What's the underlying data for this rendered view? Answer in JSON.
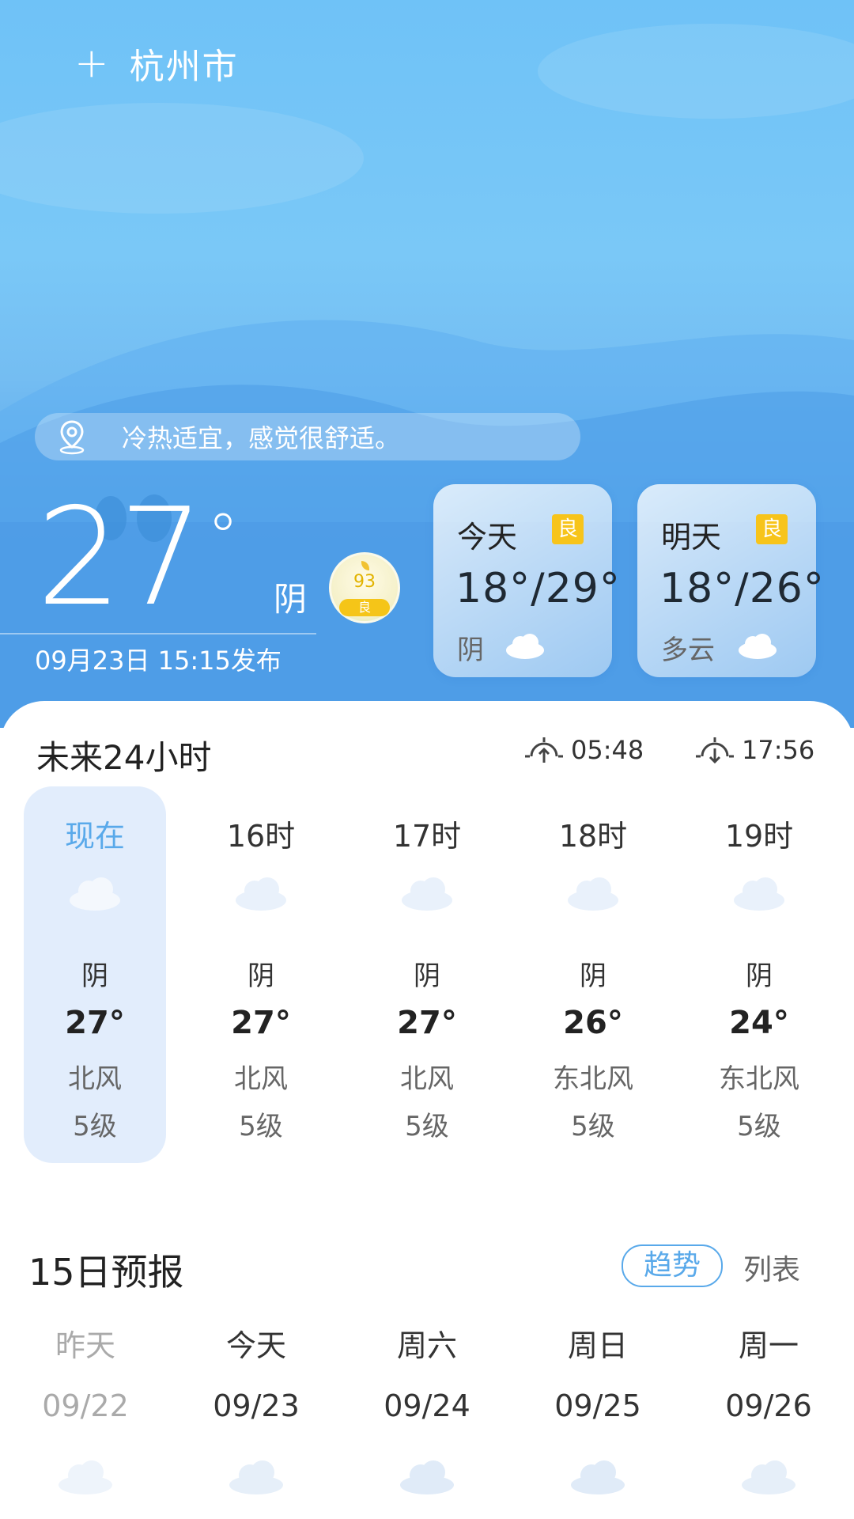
{
  "header": {
    "add_icon": "plus-icon",
    "city": "杭州市"
  },
  "tip": {
    "icon": "location-pin-icon",
    "text": "冷热适宜，感觉很舒适。"
  },
  "current": {
    "temp": "27",
    "degree": "°",
    "condition": "阴",
    "publish": "09月23日 15:15发布",
    "aqi": {
      "value": "93",
      "level": "良"
    }
  },
  "days": [
    {
      "name": "今天",
      "aqi": "良",
      "range": "18°/29°",
      "condition": "阴"
    },
    {
      "name": "明天",
      "aqi": "良",
      "range": "18°/26°",
      "condition": "多云"
    }
  ],
  "hourly": {
    "title": "未来24小时",
    "sunrise": "05:48",
    "sunset": "17:56",
    "hours": [
      {
        "label": "现在",
        "condition": "阴",
        "temp": "27°",
        "wind": "北风",
        "level": "5级"
      },
      {
        "label": "16时",
        "condition": "阴",
        "temp": "27°",
        "wind": "北风",
        "level": "5级"
      },
      {
        "label": "17时",
        "condition": "阴",
        "temp": "27°",
        "wind": "北风",
        "level": "5级"
      },
      {
        "label": "18时",
        "condition": "阴",
        "temp": "26°",
        "wind": "东北风",
        "level": "5级"
      },
      {
        "label": "19时",
        "condition": "阴",
        "temp": "24°",
        "wind": "东北风",
        "level": "5级"
      }
    ]
  },
  "forecast": {
    "title": "15日预报",
    "trend_label": "趋势",
    "list_label": "列表",
    "days": [
      {
        "weekday": "昨天",
        "date": "09/22"
      },
      {
        "weekday": "今天",
        "date": "09/23"
      },
      {
        "weekday": "周六",
        "date": "09/24"
      },
      {
        "weekday": "周日",
        "date": "09/25"
      },
      {
        "weekday": "周一",
        "date": "09/26"
      }
    ]
  },
  "colors": {
    "accent": "#59a9ea",
    "aqi_good": "#f7c41b",
    "sky": "#6fc2f7"
  }
}
